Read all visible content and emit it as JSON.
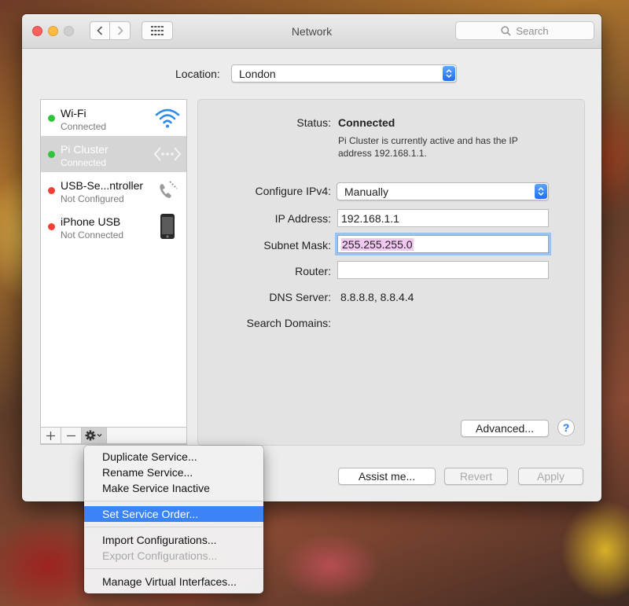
{
  "window": {
    "title": "Network",
    "search_placeholder": "Search"
  },
  "location": {
    "label": "Location:",
    "value": "London"
  },
  "services": [
    {
      "name": "Wi-Fi",
      "status": "Connected",
      "dot": "green",
      "icon": "wifi-icon"
    },
    {
      "name": "Pi Cluster",
      "status": "Connected",
      "dot": "green",
      "icon": "ethernet-icon",
      "selected": true
    },
    {
      "name": "USB-Se...ntroller",
      "status": "Not Configured",
      "dot": "red",
      "icon": "phone-icon"
    },
    {
      "name": "iPhone USB",
      "status": "Not Connected",
      "dot": "red",
      "icon": "iphone-icon"
    }
  ],
  "detail": {
    "status_label": "Status:",
    "status_value": "Connected",
    "status_desc": "Pi Cluster is currently active and has the IP address 192.168.1.1.",
    "configure_label": "Configure IPv4:",
    "configure_value": "Manually",
    "ip_label": "IP Address:",
    "ip_value": "192.168.1.1",
    "subnet_label": "Subnet Mask:",
    "subnet_value": "255.255.255.0",
    "router_label": "Router:",
    "router_value": "",
    "dns_label": "DNS Server:",
    "dns_value": "8.8.8.8, 8.8.4.4",
    "search_domains_label": "Search Domains:",
    "advanced_label": "Advanced...",
    "help_label": "?"
  },
  "footer": {
    "assist_label": "Assist me...",
    "revert_label": "Revert",
    "apply_label": "Apply"
  },
  "gear_menu": {
    "items": [
      {
        "label": "Duplicate Service...",
        "enabled": true
      },
      {
        "label": "Rename Service...",
        "enabled": true
      },
      {
        "label": "Make Service Inactive",
        "enabled": true
      },
      {
        "label": "Set Service Order...",
        "enabled": true,
        "highlighted": true
      },
      {
        "label": "Import Configurations...",
        "enabled": true
      },
      {
        "label": "Export Configurations...",
        "enabled": false
      },
      {
        "label": "Manage Virtual Interfaces...",
        "enabled": true
      }
    ]
  },
  "colors": {
    "accent": "#3a84f7",
    "status_green": "#31c43b",
    "status_red": "#f33f36",
    "selection_highlight": "#f0c8f0"
  }
}
